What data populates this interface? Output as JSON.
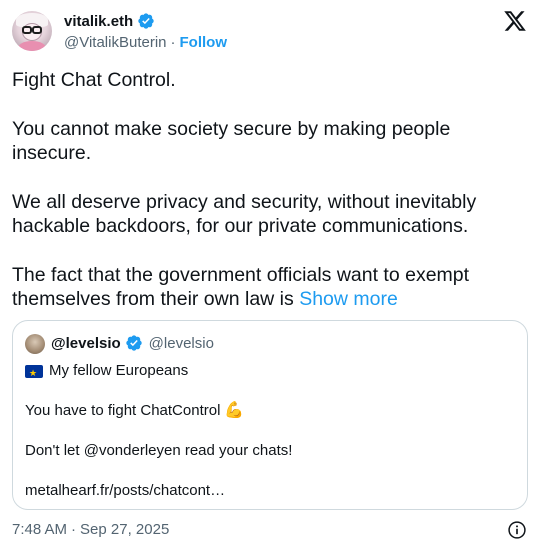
{
  "author": {
    "display_name": "vitalik.eth",
    "handle": "@VitalikButerin",
    "separator": "·",
    "follow_label": "Follow",
    "verified": true
  },
  "tweet": {
    "paragraphs": [
      "Fight Chat Control.",
      "You cannot make society secure by making people insecure.",
      "We all deserve privacy and security, without inevitably hackable backdoors, for our private communications."
    ],
    "last_paragraph": "The fact that the government officials want to exempt themselves from their own law is",
    "show_more_label": "Show more"
  },
  "quote": {
    "display_name": "@levelsio",
    "handle": "@levelsio",
    "verified": true,
    "lines": {
      "l1": "My fellow Europeans",
      "l2": "You have to fight ChatControl",
      "l3": "Don't let @vonderleyen read your chats!",
      "l4": "metalhearf.fr/posts/chatcont…"
    }
  },
  "footer": {
    "time": "7:48 AM",
    "separator": "·",
    "date": "Sep 27, 2025"
  },
  "colors": {
    "accent": "#1d9bf0",
    "text": "#0f1419",
    "secondary": "#536471",
    "border": "#cfd9de"
  },
  "icons": {
    "brand": "x-logo-icon",
    "verified": "verified-badge-icon",
    "info": "info-icon",
    "flag": "eu-flag-icon",
    "muscle": "flexed-biceps-icon"
  }
}
